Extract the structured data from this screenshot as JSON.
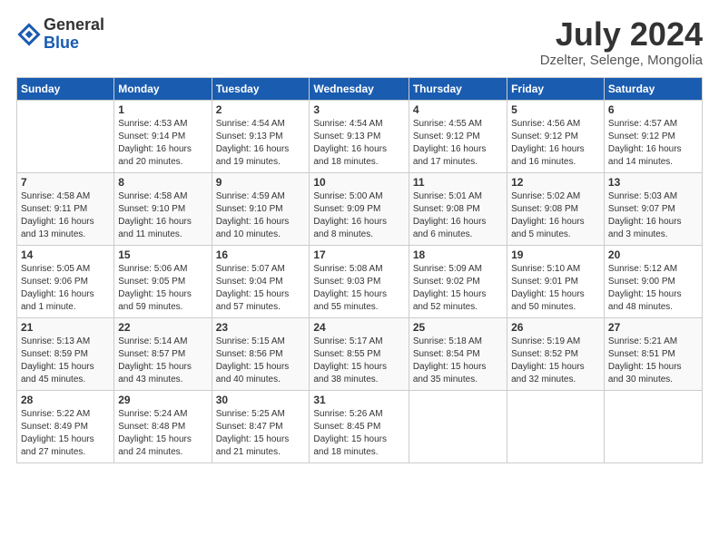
{
  "header": {
    "logo_general": "General",
    "logo_blue": "Blue",
    "month_year": "July 2024",
    "location": "Dzelter, Selenge, Mongolia"
  },
  "calendar": {
    "days_of_week": [
      "Sunday",
      "Monday",
      "Tuesday",
      "Wednesday",
      "Thursday",
      "Friday",
      "Saturday"
    ],
    "weeks": [
      [
        {
          "day": "",
          "info": ""
        },
        {
          "day": "1",
          "info": "Sunrise: 4:53 AM\nSunset: 9:14 PM\nDaylight: 16 hours\nand 20 minutes."
        },
        {
          "day": "2",
          "info": "Sunrise: 4:54 AM\nSunset: 9:13 PM\nDaylight: 16 hours\nand 19 minutes."
        },
        {
          "day": "3",
          "info": "Sunrise: 4:54 AM\nSunset: 9:13 PM\nDaylight: 16 hours\nand 18 minutes."
        },
        {
          "day": "4",
          "info": "Sunrise: 4:55 AM\nSunset: 9:12 PM\nDaylight: 16 hours\nand 17 minutes."
        },
        {
          "day": "5",
          "info": "Sunrise: 4:56 AM\nSunset: 9:12 PM\nDaylight: 16 hours\nand 16 minutes."
        },
        {
          "day": "6",
          "info": "Sunrise: 4:57 AM\nSunset: 9:12 PM\nDaylight: 16 hours\nand 14 minutes."
        }
      ],
      [
        {
          "day": "7",
          "info": "Sunrise: 4:58 AM\nSunset: 9:11 PM\nDaylight: 16 hours\nand 13 minutes."
        },
        {
          "day": "8",
          "info": "Sunrise: 4:58 AM\nSunset: 9:10 PM\nDaylight: 16 hours\nand 11 minutes."
        },
        {
          "day": "9",
          "info": "Sunrise: 4:59 AM\nSunset: 9:10 PM\nDaylight: 16 hours\nand 10 minutes."
        },
        {
          "day": "10",
          "info": "Sunrise: 5:00 AM\nSunset: 9:09 PM\nDaylight: 16 hours\nand 8 minutes."
        },
        {
          "day": "11",
          "info": "Sunrise: 5:01 AM\nSunset: 9:08 PM\nDaylight: 16 hours\nand 6 minutes."
        },
        {
          "day": "12",
          "info": "Sunrise: 5:02 AM\nSunset: 9:08 PM\nDaylight: 16 hours\nand 5 minutes."
        },
        {
          "day": "13",
          "info": "Sunrise: 5:03 AM\nSunset: 9:07 PM\nDaylight: 16 hours\nand 3 minutes."
        }
      ],
      [
        {
          "day": "14",
          "info": "Sunrise: 5:05 AM\nSunset: 9:06 PM\nDaylight: 16 hours\nand 1 minute."
        },
        {
          "day": "15",
          "info": "Sunrise: 5:06 AM\nSunset: 9:05 PM\nDaylight: 15 hours\nand 59 minutes."
        },
        {
          "day": "16",
          "info": "Sunrise: 5:07 AM\nSunset: 9:04 PM\nDaylight: 15 hours\nand 57 minutes."
        },
        {
          "day": "17",
          "info": "Sunrise: 5:08 AM\nSunset: 9:03 PM\nDaylight: 15 hours\nand 55 minutes."
        },
        {
          "day": "18",
          "info": "Sunrise: 5:09 AM\nSunset: 9:02 PM\nDaylight: 15 hours\nand 52 minutes."
        },
        {
          "day": "19",
          "info": "Sunrise: 5:10 AM\nSunset: 9:01 PM\nDaylight: 15 hours\nand 50 minutes."
        },
        {
          "day": "20",
          "info": "Sunrise: 5:12 AM\nSunset: 9:00 PM\nDaylight: 15 hours\nand 48 minutes."
        }
      ],
      [
        {
          "day": "21",
          "info": "Sunrise: 5:13 AM\nSunset: 8:59 PM\nDaylight: 15 hours\nand 45 minutes."
        },
        {
          "day": "22",
          "info": "Sunrise: 5:14 AM\nSunset: 8:57 PM\nDaylight: 15 hours\nand 43 minutes."
        },
        {
          "day": "23",
          "info": "Sunrise: 5:15 AM\nSunset: 8:56 PM\nDaylight: 15 hours\nand 40 minutes."
        },
        {
          "day": "24",
          "info": "Sunrise: 5:17 AM\nSunset: 8:55 PM\nDaylight: 15 hours\nand 38 minutes."
        },
        {
          "day": "25",
          "info": "Sunrise: 5:18 AM\nSunset: 8:54 PM\nDaylight: 15 hours\nand 35 minutes."
        },
        {
          "day": "26",
          "info": "Sunrise: 5:19 AM\nSunset: 8:52 PM\nDaylight: 15 hours\nand 32 minutes."
        },
        {
          "day": "27",
          "info": "Sunrise: 5:21 AM\nSunset: 8:51 PM\nDaylight: 15 hours\nand 30 minutes."
        }
      ],
      [
        {
          "day": "28",
          "info": "Sunrise: 5:22 AM\nSunset: 8:49 PM\nDaylight: 15 hours\nand 27 minutes."
        },
        {
          "day": "29",
          "info": "Sunrise: 5:24 AM\nSunset: 8:48 PM\nDaylight: 15 hours\nand 24 minutes."
        },
        {
          "day": "30",
          "info": "Sunrise: 5:25 AM\nSunset: 8:47 PM\nDaylight: 15 hours\nand 21 minutes."
        },
        {
          "day": "31",
          "info": "Sunrise: 5:26 AM\nSunset: 8:45 PM\nDaylight: 15 hours\nand 18 minutes."
        },
        {
          "day": "",
          "info": ""
        },
        {
          "day": "",
          "info": ""
        },
        {
          "day": "",
          "info": ""
        }
      ]
    ]
  }
}
